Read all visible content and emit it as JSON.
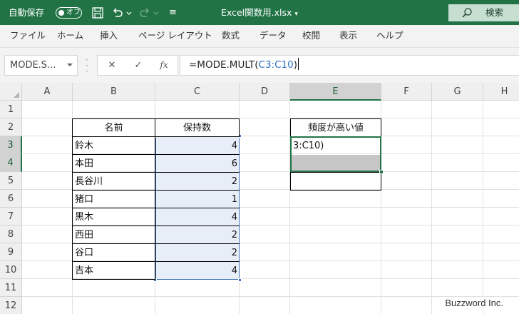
{
  "titlebar": {
    "autosave_label": "自動保存",
    "autosave_toggle": "オフ",
    "filename": "Excel関数用.xlsx",
    "filename_caret": "▾",
    "search_label": "検索",
    "qat_more": "≡"
  },
  "ribbon": {
    "tabs": [
      "ファイル",
      "ホーム",
      "挿入",
      "ページ レイアウト",
      "数式",
      "データ",
      "校閲",
      "表示",
      "ヘルプ"
    ]
  },
  "formula_bar": {
    "name_box": "MODE.S...",
    "cancel": "✕",
    "enter": "✓",
    "fx": "fx",
    "formula_prefix": "=MODE.MULT(",
    "formula_ref": "C3:C10",
    "formula_suffix": ")"
  },
  "grid": {
    "columns": [
      "A",
      "B",
      "C",
      "D",
      "E",
      "F",
      "G",
      "H"
    ],
    "rows": [
      "1",
      "2",
      "3",
      "4",
      "5",
      "6",
      "7",
      "8",
      "9",
      "10",
      "11",
      "12"
    ],
    "selected_column": "E"
  },
  "table": {
    "header_name": "名前",
    "header_value": "保持数",
    "rows": [
      {
        "name": "鈴木",
        "value": "4"
      },
      {
        "name": "本田",
        "value": "6"
      },
      {
        "name": "長谷川",
        "value": "2"
      },
      {
        "name": "猪口",
        "value": "1"
      },
      {
        "name": "黒木",
        "value": "4"
      },
      {
        "name": "西田",
        "value": "2"
      },
      {
        "name": "谷口",
        "value": "2"
      },
      {
        "name": "吉本",
        "value": "4"
      }
    ]
  },
  "result": {
    "header": "頻度が高い値",
    "editing_text": "3:C10)"
  },
  "watermark": "Buzzword Inc."
}
